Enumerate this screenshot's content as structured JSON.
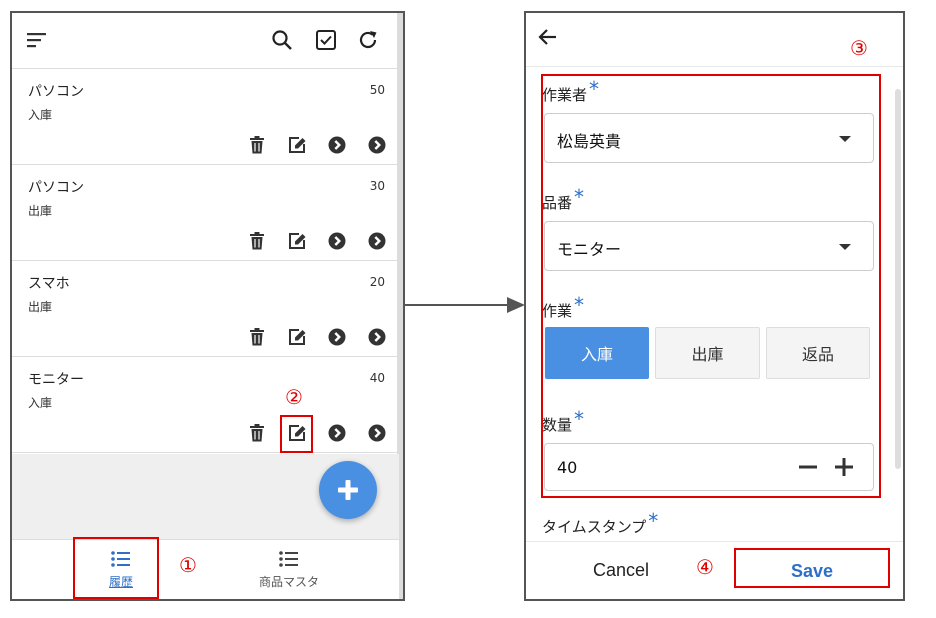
{
  "left_screen": {
    "toolbar": {
      "menu_icon": "sort-menu-icon",
      "search_icon": "search-icon",
      "checkbox_icon": "checkbox-icon",
      "refresh_icon": "refresh-icon"
    },
    "items": [
      {
        "name": "パソコン",
        "qty": "50",
        "kind": "入庫"
      },
      {
        "name": "パソコン",
        "qty": "30",
        "kind": "出庫"
      },
      {
        "name": "スマホ",
        "qty": "20",
        "kind": "出庫"
      },
      {
        "name": "モニター",
        "qty": "40",
        "kind": "入庫"
      }
    ],
    "item_action_icons": [
      "trash-icon",
      "edit-icon",
      "chevron-circle-icon",
      "chevron-circle-icon"
    ],
    "fab_icon": "plus-icon",
    "bottom_nav": [
      {
        "label": "履歴",
        "icon": "list-icon",
        "active": true
      },
      {
        "label": "商品マスタ",
        "icon": "list-icon",
        "active": false
      }
    ]
  },
  "right_screen": {
    "back_icon": "arrow-left-icon",
    "form": {
      "worker": {
        "label": "作業者",
        "required": "*",
        "value": "松島英貴"
      },
      "product": {
        "label": "品番",
        "required": "*",
        "value": "モニター"
      },
      "operation": {
        "label": "作業",
        "required": "*",
        "options": [
          "入庫",
          "出庫",
          "返品"
        ],
        "selected": "入庫"
      },
      "quantity": {
        "label": "数量",
        "required": "*",
        "value": "40"
      },
      "timestamp": {
        "label": "タイムスタンプ",
        "required": "*"
      }
    },
    "footer": {
      "cancel_label": "Cancel",
      "save_label": "Save"
    }
  },
  "annotations": [
    "①",
    "②",
    "③",
    "④"
  ],
  "colors": {
    "accent": "#4a90e2",
    "link": "#2e6fc7",
    "annotation": "#e00000"
  }
}
